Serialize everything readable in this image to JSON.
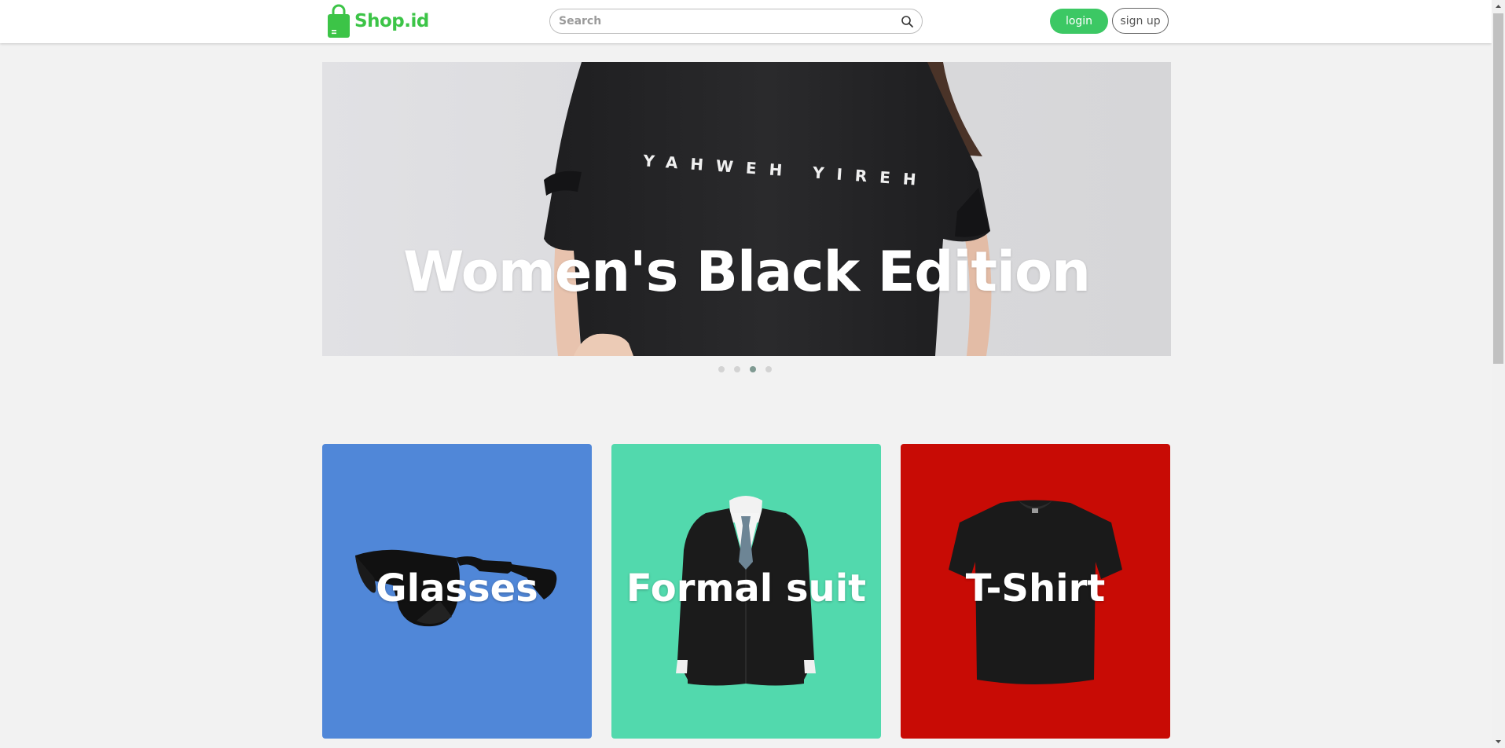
{
  "header": {
    "logo_text": "Shop.id",
    "search_placeholder": "Search",
    "login_label": "login",
    "signup_label": "sign up"
  },
  "banner": {
    "caption": "Women's Black Edition",
    "shirt_print": "YAHWEH YIREH",
    "slide_count": 4,
    "active_slide": 3
  },
  "categories": [
    {
      "title": "Glasses",
      "color": "#5087d8",
      "icon": "sunglasses-icon"
    },
    {
      "title": "Formal suit",
      "color": "#52d9ad",
      "icon": "suit-icon"
    },
    {
      "title": "T-Shirt",
      "color": "#c80b05",
      "icon": "tshirt-icon"
    }
  ],
  "colors": {
    "brand": "#3cc447",
    "login_button": "#3cc864",
    "page_background": "#f2f2f2"
  }
}
